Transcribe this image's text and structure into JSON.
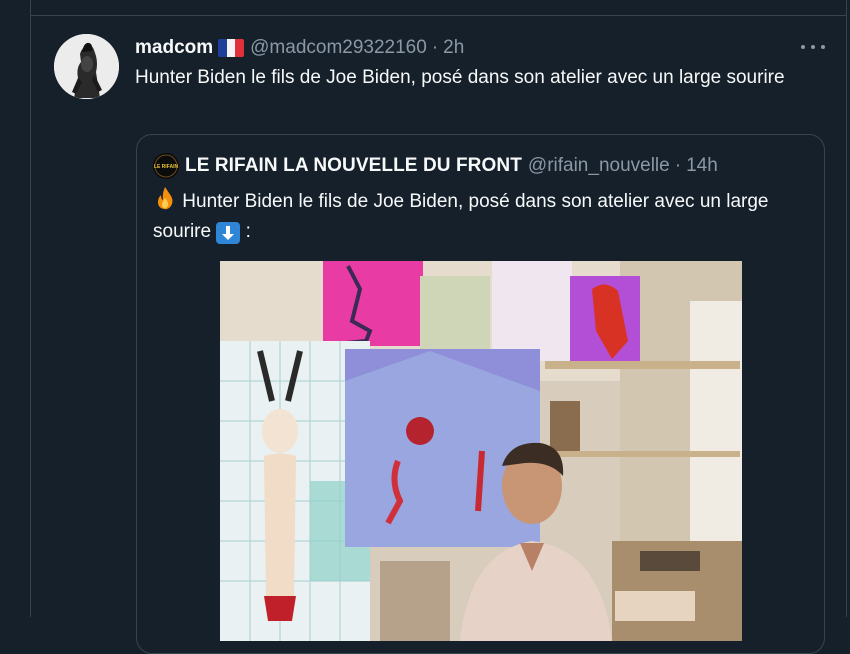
{
  "tweet": {
    "display_name": "madcom",
    "flag_icon": "france-flag-icon",
    "handle": "@madcom29322160",
    "separator": "·",
    "time": "2h",
    "more_icon": "more-horizontal-icon",
    "text": "Hunter Biden le fils de Joe Biden, posé dans son atelier avec un large sourire"
  },
  "quote": {
    "display_name": "LE RIFAIN LA NOUVELLE DU FRONT",
    "avatar_logo_text": "LE RIFAIN",
    "handle": "@rifain_nouvelle",
    "separator": "·",
    "time": "14h",
    "fire_icon": "fire-emoji-icon",
    "text": "Hunter Biden le fils de Joe Biden, posé dans son atelier avec un large sourire",
    "arrow_icon": "down-arrow-emoji-icon",
    "text_suffix": ":"
  },
  "colors": {
    "background": "#15202b",
    "border": "#38444d",
    "text_primary": "#f7f9f9",
    "text_muted": "#8b98a5"
  }
}
